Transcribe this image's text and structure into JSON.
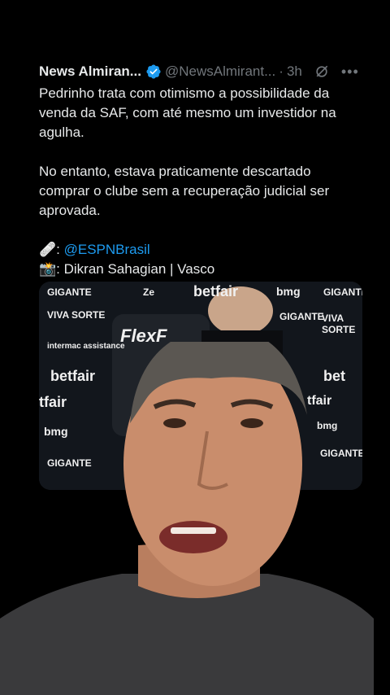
{
  "tweet": {
    "author_name": "News Almiran...",
    "handle": "@NewsAlmirant...",
    "separator": "·",
    "time": "3h",
    "paragraphs": [
      [
        "Pedrinho trata com otimismo a possibilidade da",
        "venda da SAF, com até mesmo um investidor na",
        "agulha."
      ],
      [
        "No entanto, estava praticamente descartado",
        "comprar o clube sem a recuperação judicial ser",
        "aprovada."
      ]
    ],
    "credit_1_prefix": "🩹: ",
    "credit_1_mention": "@ESPNBrasil",
    "credit_2_prefix": "📸: ",
    "credit_2_text": "Dikran Sahagian | Vasco"
  },
  "media": {
    "logos": [
      "GIGANTE",
      "Ze",
      "betfair",
      "bmg",
      "GIGANTE",
      "VIVA SORTE",
      "FlexF",
      "GIGANTE",
      "VIVA SORTE",
      "intermac assistance",
      "betfair",
      "bet",
      "tfair",
      "tfair",
      "bmg",
      "bmg",
      "GIGANTE",
      "GIGANTE"
    ]
  },
  "colors": {
    "accent": "#1d9bf0",
    "muted": "#71767b",
    "text": "#e7e9ea",
    "background": "#000000"
  },
  "icons": [
    "verified-badge-icon",
    "grok-icon",
    "more-options-icon"
  ]
}
